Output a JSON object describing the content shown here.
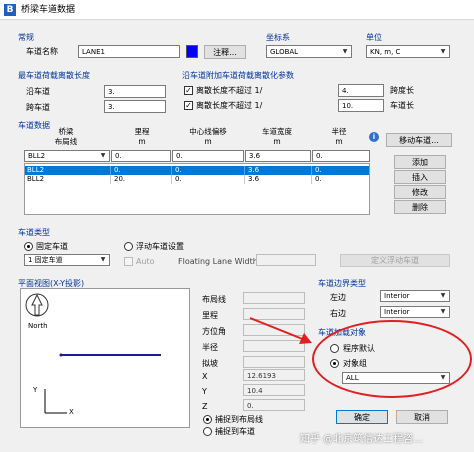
{
  "window": {
    "title": "桥梁车道数据",
    "icon_letter": "B"
  },
  "general": {
    "group_label": "常规",
    "lane_name_label": "车道名称",
    "lane_name_value": "LANE1",
    "color_swatch": "#0000ff",
    "comment_button": "注释..."
  },
  "coord_system": {
    "group_label": "坐标系",
    "value": "GLOBAL"
  },
  "units": {
    "group_label": "单位",
    "value": "KN, m, C"
  },
  "min_length": {
    "group_label": "最车道荷载离散长度",
    "along_label": "沿车道",
    "along_value": "3.",
    "across_label": "跨车道",
    "across_value": "3."
  },
  "max_length": {
    "group_label": "沿车道附加车道荷载离散化参数",
    "chk1_label": "离散长度不超过 1/",
    "chk1_checked": true,
    "chk1_value": "4.",
    "chk1_suffix": "跨度长",
    "chk2_label": "离散长度不超过 1/",
    "chk2_checked": true,
    "chk2_value": "10.",
    "chk2_suffix": "车道长"
  },
  "lane_data": {
    "group_label": "车道数据",
    "columns": [
      "桥梁\n布局线",
      "里程\nm",
      "中心线偏移\nm",
      "车道宽度\nm",
      "半径\nm"
    ],
    "edit_row": [
      "BLL2",
      "0.",
      "0.",
      "3.6",
      "0."
    ],
    "rows": [
      {
        "cells": [
          "BLL2",
          "0.",
          "0.",
          "3.6",
          "0."
        ],
        "selected": true
      },
      {
        "cells": [
          "BLL2",
          "20.",
          "0.",
          "3.6",
          "0."
        ],
        "selected": false
      }
    ],
    "info_icon": "info-icon",
    "move_lane_button": "移动车道...",
    "add_button": "添加",
    "insert_button": "插入",
    "modify_button": "修改",
    "delete_button": "删除"
  },
  "lane_type": {
    "group_label": "车道类型",
    "fixed_label": "固定车道",
    "float_label": "浮动车道设置",
    "selected": "fixed",
    "fixed_dropdown": "1 固定车道",
    "auto_label": "Auto",
    "floating_width_label": "Floating Lane Width",
    "define_float_button": "定义浮动车道"
  },
  "plan": {
    "group_label": "平面视图(X-Y投影)",
    "north_label": "North",
    "axis_x": "X",
    "axis_y": "Y",
    "field_layout": "布局线",
    "field_station": "里程",
    "field_bearing": "方位角",
    "field_radius": "半径",
    "field_grade": "拟坡",
    "x_label": "X",
    "x_value": "12.6193",
    "y_label": "Y",
    "y_value": "10.4",
    "z_label": "Z",
    "z_value": "0.",
    "snap_layout": "捕捉到布局线",
    "snap_lane": "捕捉到车道",
    "snap_selected": "layout"
  },
  "boundary": {
    "group_label": "车道边界类型",
    "left_label": "左边",
    "left_value": "Interior",
    "right_label": "右边",
    "right_value": "Interior"
  },
  "load_objects": {
    "group_label": "车道加载对象",
    "program_default": "程序默认",
    "object_group": "对象组",
    "selected": "group",
    "group_value": "ALL"
  },
  "footer": {
    "ok_button": "确定",
    "cancel_button": "取消"
  },
  "watermark": "知乎 @北京筑信达工程咨...",
  "colors": {
    "accent": "#0078d7",
    "annotation": "#e02020",
    "group_label": "#003399"
  }
}
